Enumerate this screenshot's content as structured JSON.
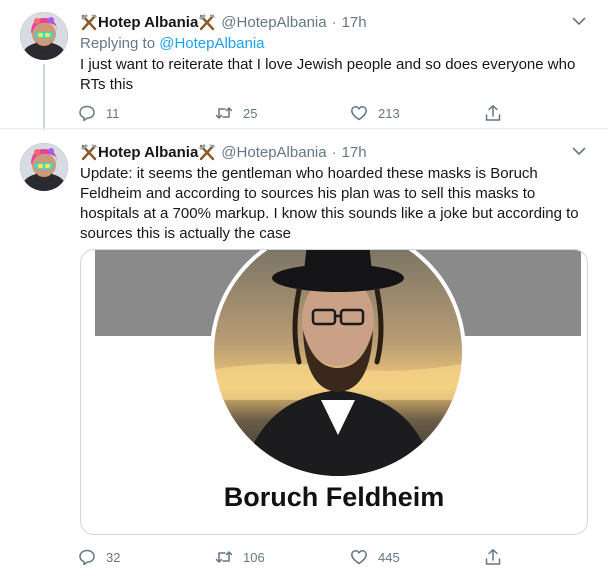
{
  "tweets": [
    {
      "author": {
        "name": "Hotep Albania",
        "handle": "@HotepAlbania"
      },
      "time": "17h",
      "replying_to_prefix": "Replying to",
      "replying_to_handle": "@HotepAlbania",
      "text": "I just want to reiterate that I love Jewish people and so does everyone who RTs this",
      "stats": {
        "replies": "11",
        "retweets": "25",
        "likes": "213"
      }
    },
    {
      "author": {
        "name": "Hotep Albania",
        "handle": "@HotepAlbania"
      },
      "time": "17h",
      "text": "Update: it seems the gentleman who hoarded these masks is Boruch Feldheim and according to sources his plan was to sell this masks to hospitals at a 700% markup. I know this sounds like a joke but according to sources this is actually the case",
      "card": {
        "caption": "Boruch Feldheim"
      },
      "stats": {
        "replies": "32",
        "retweets": "106",
        "likes": "445"
      }
    }
  ],
  "colors": {
    "accent": "#1da1f2",
    "muted": "#657786",
    "text": "#14171a",
    "border": "#e6ecf0"
  },
  "icons": [
    "hammer-pick-icon",
    "chevron-down-icon",
    "reply-icon",
    "retweet-icon",
    "like-icon",
    "share-icon"
  ]
}
